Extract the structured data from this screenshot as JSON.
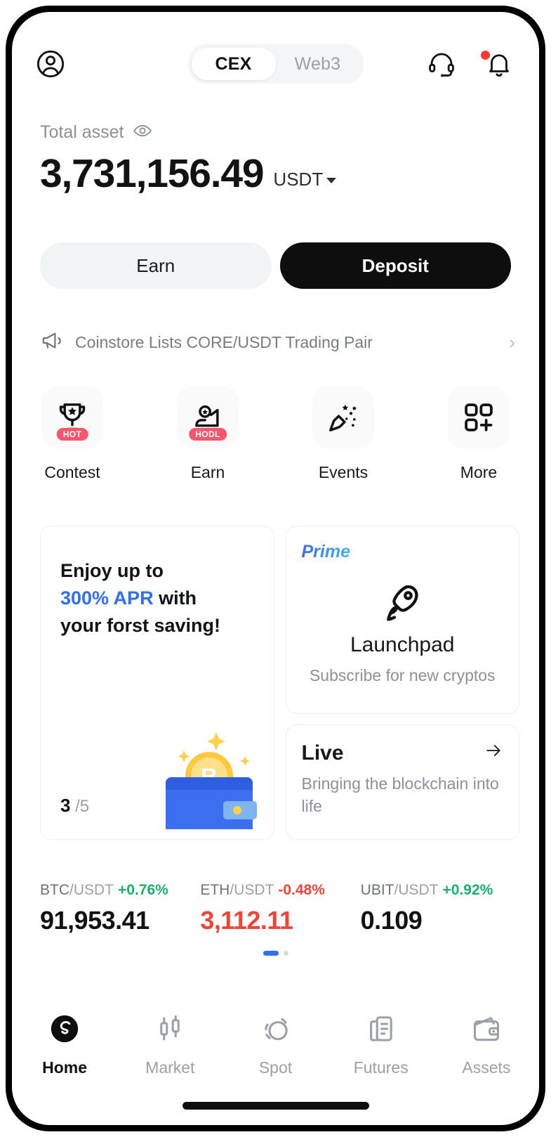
{
  "header": {
    "avatar_icon": "user-circle-icon",
    "segments": [
      {
        "label": "CEX",
        "active": true
      },
      {
        "label": "Web3",
        "active": false
      }
    ],
    "support_icon": "headset-icon",
    "notification_icon": "bell-icon",
    "has_notification_dot": true
  },
  "balance": {
    "label": "Total asset",
    "visibility_icon": "eye-icon",
    "amount": "3,731,156.49",
    "currency": "USDT",
    "currency_dropdown_icon": "caret-down-icon"
  },
  "actions": {
    "earn_label": "Earn",
    "deposit_label": "Deposit"
  },
  "announcement": {
    "icon": "megaphone-icon",
    "text": "Coinstore Lists CORE/USDT Trading Pair",
    "chevron": "›"
  },
  "quick_actions": [
    {
      "label": "Contest",
      "icon": "trophy-icon",
      "badge": "HOT"
    },
    {
      "label": "Earn",
      "icon": "piggy-hand-icon",
      "badge": "HODL"
    },
    {
      "label": "Events",
      "icon": "party-popper-icon",
      "badge": ""
    },
    {
      "label": "More",
      "icon": "grid-plus-icon",
      "badge": ""
    }
  ],
  "promo_card": {
    "line1": "Enjoy up to",
    "highlight": "300% APR",
    "line2_rest": " with",
    "line3": "your forst saving!",
    "highlight_color": "#2f6dfb",
    "counter_current": "3",
    "counter_total": "/5",
    "illustration": "wallet-with-bitcoin-icon"
  },
  "launchpad_card": {
    "tag": "Prime",
    "icon": "rocket-icon",
    "title": "Launchpad",
    "subtitle": "Subscribe for new cryptos"
  },
  "live_card": {
    "title": "Live",
    "arrow_icon": "arrow-right-icon",
    "subtitle": "Bringing the blockchain into life"
  },
  "tickers": [
    {
      "symbol": "BTC",
      "quote": "/USDT",
      "change": "+0.76%",
      "direction": "up",
      "price": "91,953.41"
    },
    {
      "symbol": "ETH",
      "quote": "/USDT",
      "change": "-0.48%",
      "direction": "down",
      "price": "3,112.11"
    },
    {
      "symbol": "UBIT",
      "quote": "/USDT",
      "change": "+0.92%",
      "direction": "up",
      "price": "0.109"
    }
  ],
  "pagination": {
    "total": 2,
    "active_index": 0,
    "active_color": "#2f6dfb"
  },
  "bottom_nav": [
    {
      "label": "Home",
      "icon": "coinstore-logo-icon",
      "active": true
    },
    {
      "label": "Market",
      "icon": "candlestick-icon",
      "active": false
    },
    {
      "label": "Spot",
      "icon": "swap-circles-icon",
      "active": false
    },
    {
      "label": "Futures",
      "icon": "document-chart-icon",
      "active": false
    },
    {
      "label": "Assets",
      "icon": "wallet-icon",
      "active": false
    }
  ],
  "colors": {
    "accent_blue": "#2f6dfb",
    "up_green": "#17b26a",
    "down_red": "#f04438",
    "badge_red": "#f8566c",
    "dark": "#0e0e0e"
  }
}
